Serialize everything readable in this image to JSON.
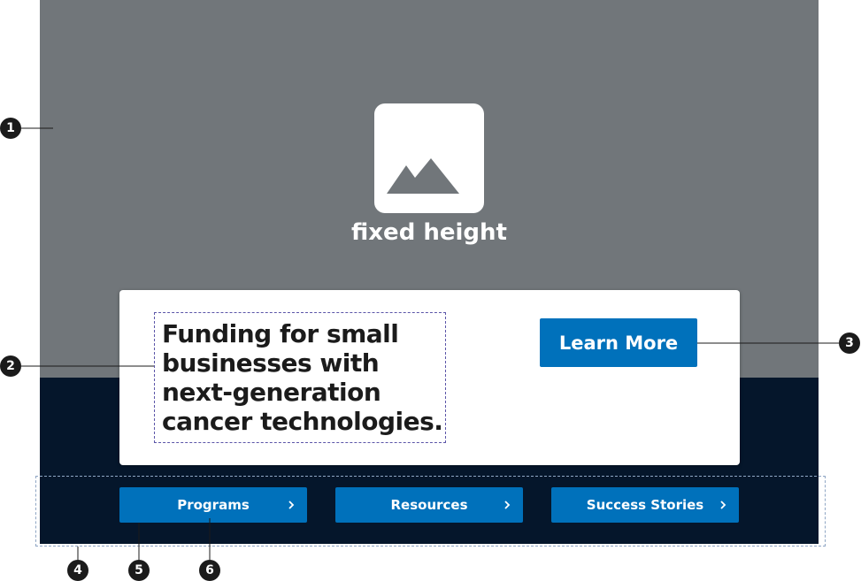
{
  "hero": {
    "placeholder_icon": "image-placeholder-icon",
    "placeholder_label": "fixed height",
    "background_color": "#71767a"
  },
  "card": {
    "heading": "Funding for small businesses with next-generation cancer technologies.",
    "cta_label": "Learn More",
    "cta_color": "#0071bb"
  },
  "nav": {
    "background_color": "#05162b",
    "items": [
      {
        "label": "Programs",
        "icon": "chevron-right-icon"
      },
      {
        "label": "Resources",
        "icon": "chevron-right-icon"
      },
      {
        "label": "Success Stories",
        "icon": "chevron-right-icon"
      }
    ]
  },
  "callouts": [
    "1",
    "2",
    "3",
    "4",
    "5",
    "6"
  ]
}
